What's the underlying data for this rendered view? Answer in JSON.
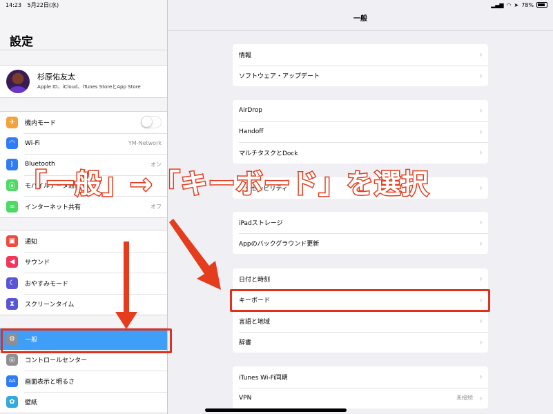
{
  "status": {
    "time": "14:23",
    "date": "5月22日(水)",
    "battery": "78%"
  },
  "sidebar": {
    "title": "設定",
    "profile": {
      "name": "杉原佑友太",
      "subtitle": "Apple ID、iCloud、iTunes StoreとApp Store"
    },
    "group1": [
      {
        "label": "機内モード",
        "icon": "airplane-icon",
        "color": "#f3a33b",
        "glyph": "✈",
        "toggle": true
      },
      {
        "label": "Wi-Fi",
        "icon": "wifi-icon",
        "color": "#2f7cf6",
        "glyph": "◠",
        "value": "YM-Network"
      },
      {
        "label": "Bluetooth",
        "icon": "bluetooth-icon",
        "color": "#2f7cf6",
        "glyph": "ᛒ",
        "value": "オン"
      },
      {
        "label": "モバイルデータ通信",
        "icon": "cellular-icon",
        "color": "#4cd964",
        "glyph": "⦿",
        "value": ""
      },
      {
        "label": "インターネット共有",
        "icon": "hotspot-icon",
        "color": "#4cd964",
        "glyph": "∞",
        "value": "オフ"
      }
    ],
    "group2": [
      {
        "label": "通知",
        "icon": "notifications-icon",
        "color": "#f04a3d",
        "glyph": "▣"
      },
      {
        "label": "サウンド",
        "icon": "sound-icon",
        "color": "#f0365a",
        "glyph": "◀"
      },
      {
        "label": "おやすみモード",
        "icon": "moon-icon",
        "color": "#5856d6",
        "glyph": "☾"
      },
      {
        "label": "スクリーンタイム",
        "icon": "hourglass-icon",
        "color": "#5856d6",
        "glyph": "⧗"
      }
    ],
    "group3": [
      {
        "label": "一般",
        "icon": "gear-icon",
        "color": "#8e8e93",
        "glyph": "⚙",
        "selected": true
      },
      {
        "label": "コントロールセンター",
        "icon": "control-center-icon",
        "color": "#8e8e93",
        "glyph": "◎"
      },
      {
        "label": "画面表示と明るさ",
        "icon": "display-icon",
        "color": "#2f7cf6",
        "glyph": "AA"
      },
      {
        "label": "壁紙",
        "icon": "wallpaper-icon",
        "color": "#34aadc",
        "glyph": "✿"
      }
    ]
  },
  "main": {
    "title": "一般",
    "cards": [
      {
        "rows": [
          {
            "label": "情報"
          },
          {
            "label": "ソフトウェア・アップデート"
          }
        ]
      },
      {
        "rows": [
          {
            "label": "AirDrop"
          },
          {
            "label": "Handoff"
          },
          {
            "label": "マルチタスクとDock"
          }
        ]
      },
      {
        "rows": [
          {
            "label": "アクセシビリティ"
          }
        ]
      },
      {
        "rows": [
          {
            "label": "iPadストレージ"
          },
          {
            "label": "Appのバックグラウンド更新"
          }
        ]
      },
      {
        "rows": [
          {
            "label": "日付と時刻"
          },
          {
            "label": "キーボード"
          },
          {
            "label": "言語と地域"
          },
          {
            "label": "辞書"
          }
        ]
      },
      {
        "rows": [
          {
            "label": "iTunes Wi-Fi同期"
          },
          {
            "label": "VPN",
            "value": "未接続"
          }
        ]
      }
    ]
  },
  "annotation": {
    "text": "「一般」→「キーボード」を選択",
    "color": "#e0301e"
  }
}
